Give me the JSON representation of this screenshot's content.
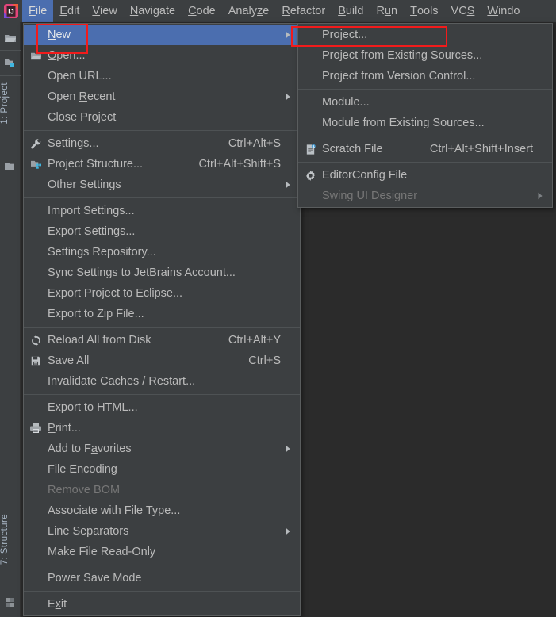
{
  "app": {
    "name": "IntelliJ IDEA",
    "logo_icon": "intellij-idea-logo"
  },
  "menubar": {
    "items": [
      {
        "label": "File",
        "mnemonic": "F",
        "active": true
      },
      {
        "label": "Edit",
        "mnemonic": "E",
        "active": false
      },
      {
        "label": "View",
        "mnemonic": "V",
        "active": false
      },
      {
        "label": "Navigate",
        "mnemonic": "N",
        "active": false
      },
      {
        "label": "Code",
        "mnemonic": "C",
        "active": false
      },
      {
        "label": "Analyze",
        "mnemonic": "z",
        "active": false
      },
      {
        "label": "Refactor",
        "mnemonic": "R",
        "active": false
      },
      {
        "label": "Build",
        "mnemonic": "B",
        "active": false
      },
      {
        "label": "Run",
        "mnemonic": "u",
        "active": false
      },
      {
        "label": "Tools",
        "mnemonic": "T",
        "active": false
      },
      {
        "label": "VCS",
        "mnemonic": "S",
        "active": false
      },
      {
        "label": "Windo",
        "mnemonic": "W",
        "active": false
      }
    ]
  },
  "toolstrip": {
    "icons": [
      {
        "name": "open-folder-icon"
      },
      {
        "name": "project-structure-icon"
      },
      {
        "name": "folder-icon"
      }
    ],
    "tabs": [
      {
        "label": "1: Project",
        "mnemonic": "1"
      },
      {
        "label": "7: Structure",
        "mnemonic": "7"
      }
    ],
    "bottom_icon": "build-variants-icon"
  },
  "file_menu": {
    "groups": [
      {
        "items": [
          {
            "label": "New",
            "mnemonic": "N",
            "icon": null,
            "shortcut": null,
            "submenu": true,
            "selected": true,
            "disabled": false
          },
          {
            "label": "Open...",
            "mnemonic": "O",
            "icon": "open-folder-icon",
            "shortcut": null,
            "submenu": false,
            "selected": false,
            "disabled": false
          },
          {
            "label": "Open URL...",
            "mnemonic": null,
            "icon": null,
            "shortcut": null,
            "submenu": false,
            "selected": false,
            "disabled": false
          },
          {
            "label": "Open Recent",
            "mnemonic": "R",
            "icon": null,
            "shortcut": null,
            "submenu": true,
            "selected": false,
            "disabled": false
          },
          {
            "label": "Close Project",
            "mnemonic": null,
            "icon": null,
            "shortcut": null,
            "submenu": false,
            "selected": false,
            "disabled": false
          }
        ]
      },
      {
        "items": [
          {
            "label": "Settings...",
            "mnemonic": "t",
            "icon": "wrench-icon",
            "shortcut": "Ctrl+Alt+S",
            "submenu": false,
            "selected": false,
            "disabled": false
          },
          {
            "label": "Project Structure...",
            "mnemonic": null,
            "icon": "project-structure-icon",
            "shortcut": "Ctrl+Alt+Shift+S",
            "submenu": false,
            "selected": false,
            "disabled": false
          },
          {
            "label": "Other Settings",
            "mnemonic": null,
            "icon": null,
            "shortcut": null,
            "submenu": true,
            "selected": false,
            "disabled": false
          }
        ]
      },
      {
        "items": [
          {
            "label": "Import Settings...",
            "mnemonic": null,
            "icon": null,
            "shortcut": null,
            "submenu": false,
            "selected": false,
            "disabled": false
          },
          {
            "label": "Export Settings...",
            "mnemonic": "E",
            "icon": null,
            "shortcut": null,
            "submenu": false,
            "selected": false,
            "disabled": false
          },
          {
            "label": "Settings Repository...",
            "mnemonic": null,
            "icon": null,
            "shortcut": null,
            "submenu": false,
            "selected": false,
            "disabled": false
          },
          {
            "label": "Sync Settings to JetBrains Account...",
            "mnemonic": null,
            "icon": null,
            "shortcut": null,
            "submenu": false,
            "selected": false,
            "disabled": false
          },
          {
            "label": "Export Project to Eclipse...",
            "mnemonic": null,
            "icon": null,
            "shortcut": null,
            "submenu": false,
            "selected": false,
            "disabled": false
          },
          {
            "label": "Export to Zip File...",
            "mnemonic": null,
            "icon": null,
            "shortcut": null,
            "submenu": false,
            "selected": false,
            "disabled": false
          }
        ]
      },
      {
        "items": [
          {
            "label": "Reload All from Disk",
            "mnemonic": null,
            "icon": "reload-icon",
            "shortcut": "Ctrl+Alt+Y",
            "submenu": false,
            "selected": false,
            "disabled": false
          },
          {
            "label": "Save All",
            "mnemonic": null,
            "icon": "save-icon",
            "shortcut": "Ctrl+S",
            "submenu": false,
            "selected": false,
            "disabled": false
          },
          {
            "label": "Invalidate Caches / Restart...",
            "mnemonic": null,
            "icon": null,
            "shortcut": null,
            "submenu": false,
            "selected": false,
            "disabled": false
          }
        ]
      },
      {
        "items": [
          {
            "label": "Export to HTML...",
            "mnemonic": "H",
            "icon": null,
            "shortcut": null,
            "submenu": false,
            "selected": false,
            "disabled": false
          },
          {
            "label": "Print...",
            "mnemonic": "P",
            "icon": "printer-icon",
            "shortcut": null,
            "submenu": false,
            "selected": false,
            "disabled": false
          },
          {
            "label": "Add to Favorites",
            "mnemonic": "a",
            "icon": null,
            "shortcut": null,
            "submenu": true,
            "selected": false,
            "disabled": false
          },
          {
            "label": "File Encoding",
            "mnemonic": null,
            "icon": null,
            "shortcut": null,
            "submenu": false,
            "selected": false,
            "disabled": false
          },
          {
            "label": "Remove BOM",
            "mnemonic": null,
            "icon": null,
            "shortcut": null,
            "submenu": false,
            "selected": false,
            "disabled": true
          },
          {
            "label": "Associate with File Type...",
            "mnemonic": null,
            "icon": null,
            "shortcut": null,
            "submenu": false,
            "selected": false,
            "disabled": false
          },
          {
            "label": "Line Separators",
            "mnemonic": null,
            "icon": null,
            "shortcut": null,
            "submenu": true,
            "selected": false,
            "disabled": false
          },
          {
            "label": "Make File Read-Only",
            "mnemonic": null,
            "icon": null,
            "shortcut": null,
            "submenu": false,
            "selected": false,
            "disabled": false
          }
        ]
      },
      {
        "items": [
          {
            "label": "Power Save Mode",
            "mnemonic": null,
            "icon": null,
            "shortcut": null,
            "submenu": false,
            "selected": false,
            "disabled": false
          }
        ]
      },
      {
        "items": [
          {
            "label": "Exit",
            "mnemonic": "x",
            "icon": null,
            "shortcut": null,
            "submenu": false,
            "selected": false,
            "disabled": false
          }
        ]
      }
    ]
  },
  "new_submenu": {
    "groups": [
      {
        "items": [
          {
            "label": "Project...",
            "icon": null,
            "shortcut": null,
            "submenu": false,
            "disabled": false
          },
          {
            "label": "Project from Existing Sources...",
            "icon": null,
            "shortcut": null,
            "submenu": false,
            "disabled": false
          },
          {
            "label": "Project from Version Control...",
            "icon": null,
            "shortcut": null,
            "submenu": false,
            "disabled": false
          }
        ]
      },
      {
        "items": [
          {
            "label": "Module...",
            "icon": null,
            "shortcut": null,
            "submenu": false,
            "disabled": false
          },
          {
            "label": "Module from Existing Sources...",
            "icon": null,
            "shortcut": null,
            "submenu": false,
            "disabled": false
          }
        ]
      },
      {
        "items": [
          {
            "label": "Scratch File",
            "icon": "scratch-file-icon",
            "shortcut": "Ctrl+Alt+Shift+Insert",
            "submenu": false,
            "disabled": false
          }
        ]
      },
      {
        "items": [
          {
            "label": "EditorConfig File",
            "icon": "gear-icon",
            "shortcut": null,
            "submenu": false,
            "disabled": false
          },
          {
            "label": "Swing UI Designer",
            "icon": null,
            "shortcut": null,
            "submenu": true,
            "disabled": true
          }
        ]
      }
    ]
  },
  "annotations": [
    {
      "name": "highlight-new",
      "target": "New"
    },
    {
      "name": "highlight-project",
      "target": "Project..."
    }
  ],
  "colors": {
    "menu_bg": "#3c3f41",
    "editor_bg": "#2b2b2b",
    "selection": "#4b6eaf",
    "text": "#bbbbbb",
    "text_disabled": "#777777",
    "separator": "#4e5254",
    "annotation_red": "#f21b1b"
  }
}
